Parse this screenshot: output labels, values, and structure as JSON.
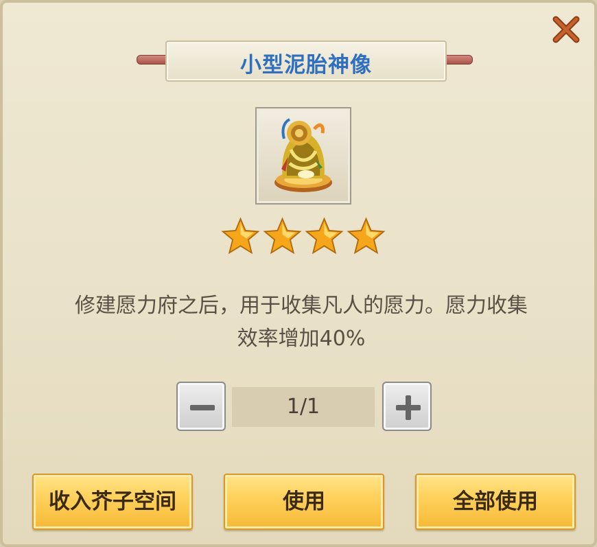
{
  "dialog": {
    "title": "小型泥胎神像",
    "close_icon": "close-x-icon",
    "item_icon": "clay-statue-icon",
    "stars": 4,
    "description_line1": "修建愿力府之后，用于收集凡人的愿力。愿力收集",
    "description_line2": "效率增加40%",
    "quantity": "1/1",
    "buttons": {
      "store": "收入芥子空间",
      "use": "使用",
      "use_all": "全部使用"
    },
    "colors": {
      "title": "#2f6fbf",
      "close": "#a04a1f",
      "star": "#f6a61a",
      "button": "#ffd25e"
    }
  }
}
